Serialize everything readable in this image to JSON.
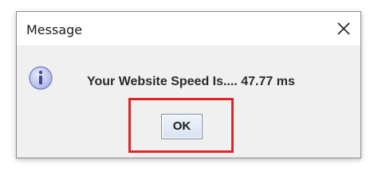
{
  "window": {
    "title": "Message",
    "close_icon": "close-icon"
  },
  "dialog": {
    "icon": "info-icon",
    "message": "Your Website Speed Is.... 47.77 ms",
    "ok_label": "OK"
  },
  "colors": {
    "highlight": "#e0242a",
    "dialog_background": "#f0f0f0",
    "titlebar_background": "#ffffff",
    "info_icon_fill": "#c7ccef"
  }
}
